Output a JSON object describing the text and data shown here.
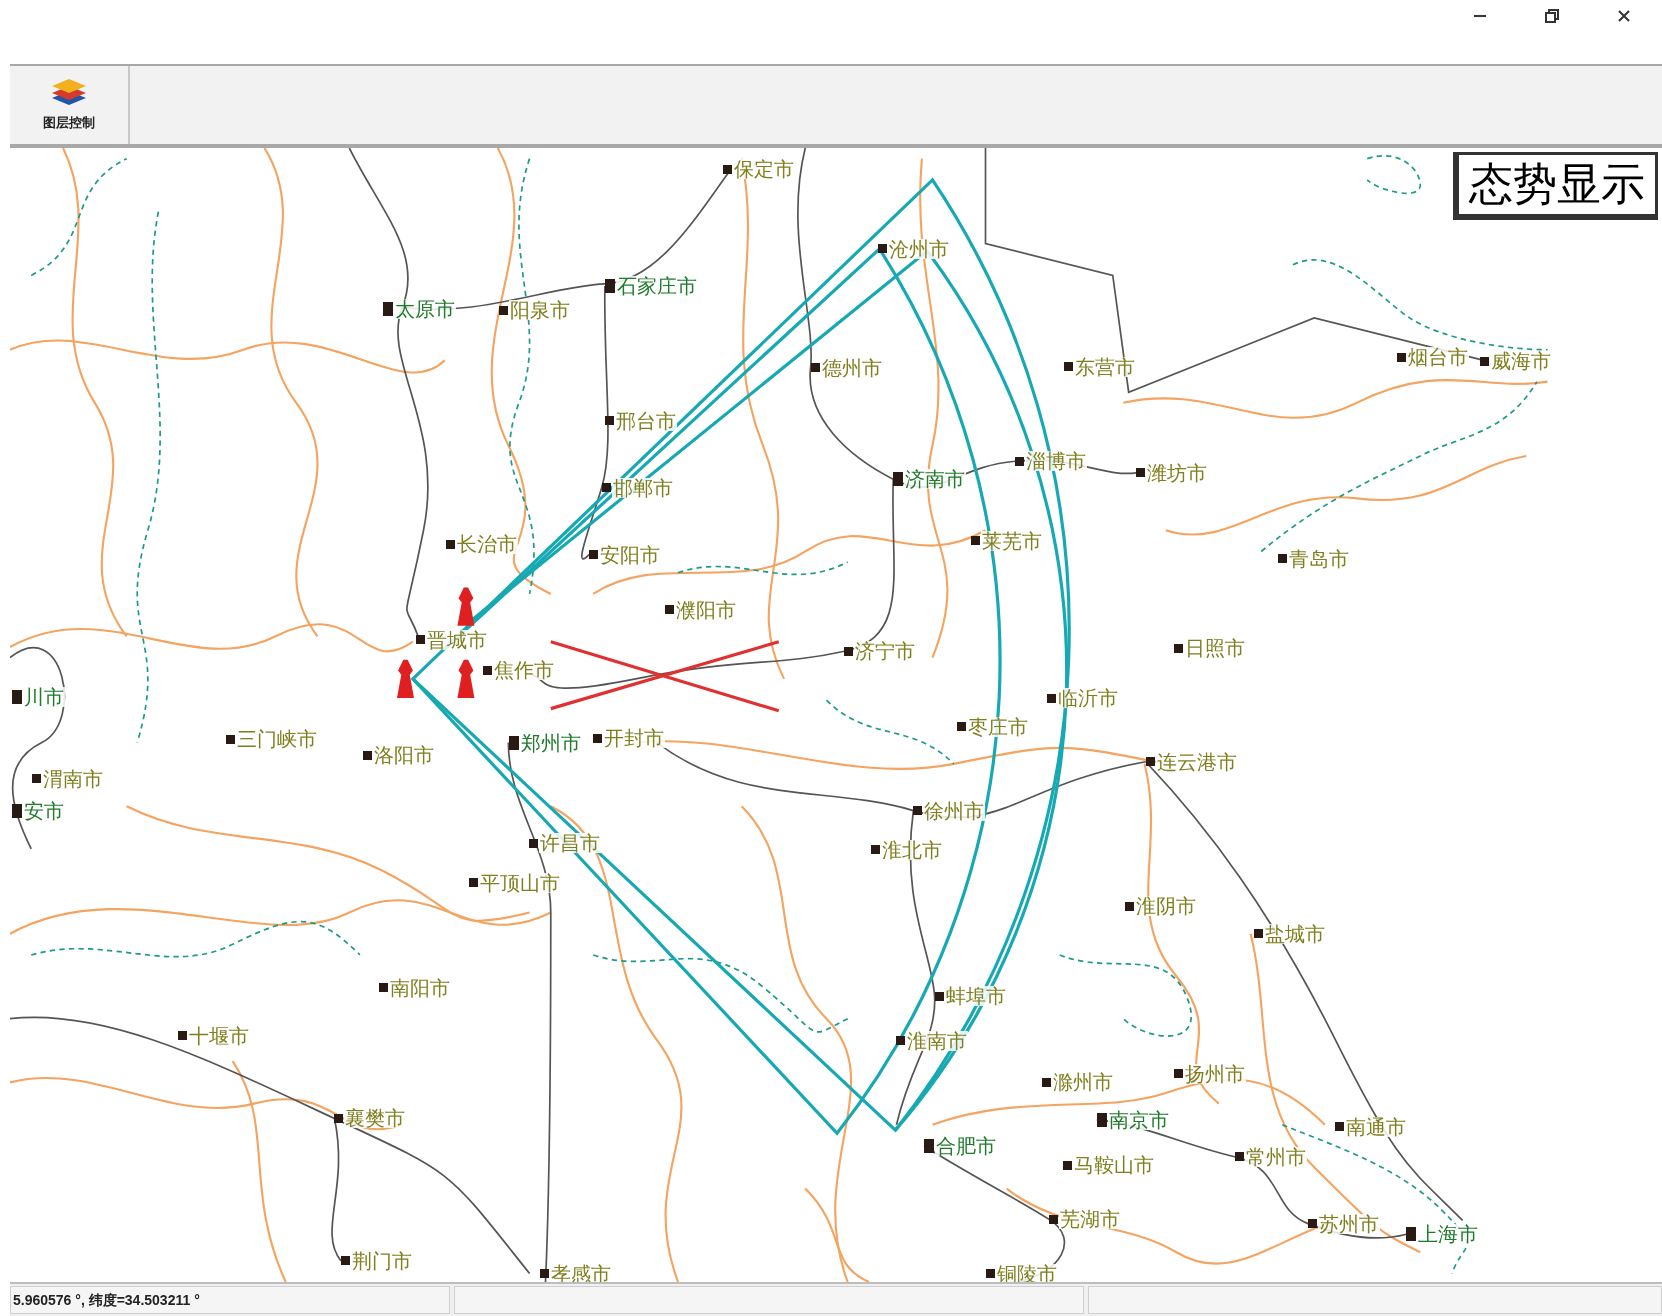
{
  "toolbar": {
    "buttons": [
      {
        "label": "图层控制"
      }
    ]
  },
  "map": {
    "overlay_title": "态势显示",
    "cities": [
      {
        "name": "保定市",
        "kind": "city"
      },
      {
        "name": "沧州市",
        "kind": "city"
      },
      {
        "name": "石家庄市",
        "kind": "capital"
      },
      {
        "name": "太原市",
        "kind": "capital"
      },
      {
        "name": "阳泉市",
        "kind": "city"
      },
      {
        "name": "德州市",
        "kind": "city"
      },
      {
        "name": "东营市",
        "kind": "city"
      },
      {
        "name": "烟台市",
        "kind": "city"
      },
      {
        "name": "威海市",
        "kind": "city"
      },
      {
        "name": "邢台市",
        "kind": "city"
      },
      {
        "name": "淄博市",
        "kind": "city"
      },
      {
        "name": "潍坊市",
        "kind": "city"
      },
      {
        "name": "济南市",
        "kind": "capital"
      },
      {
        "name": "邯郸市",
        "kind": "city"
      },
      {
        "name": "长治市",
        "kind": "city"
      },
      {
        "name": "安阳市",
        "kind": "city"
      },
      {
        "name": "莱芜市",
        "kind": "city"
      },
      {
        "name": "青岛市",
        "kind": "city"
      },
      {
        "name": "濮阳市",
        "kind": "city"
      },
      {
        "name": "晋城市",
        "kind": "city"
      },
      {
        "name": "济宁市",
        "kind": "city"
      },
      {
        "name": "日照市",
        "kind": "city"
      },
      {
        "name": "焦作市",
        "kind": "city"
      },
      {
        "name": "川市",
        "kind": "capital"
      },
      {
        "name": "临沂市",
        "kind": "city"
      },
      {
        "name": "枣庄市",
        "kind": "city"
      },
      {
        "name": "三门峡市",
        "kind": "city"
      },
      {
        "name": "洛阳市",
        "kind": "city"
      },
      {
        "name": "郑州市",
        "kind": "capital"
      },
      {
        "name": "开封市",
        "kind": "city"
      },
      {
        "name": "渭南市",
        "kind": "city"
      },
      {
        "name": "连云港市",
        "kind": "city"
      },
      {
        "name": "安市",
        "kind": "capital"
      },
      {
        "name": "徐州市",
        "kind": "city"
      },
      {
        "name": "淮北市",
        "kind": "city"
      },
      {
        "name": "许昌市",
        "kind": "city"
      },
      {
        "name": "平顶山市",
        "kind": "city"
      },
      {
        "name": "淮阴市",
        "kind": "city"
      },
      {
        "name": "盐城市",
        "kind": "city"
      },
      {
        "name": "南阳市",
        "kind": "city"
      },
      {
        "name": "蚌埠市",
        "kind": "city"
      },
      {
        "name": "十堰市",
        "kind": "city"
      },
      {
        "name": "淮南市",
        "kind": "city"
      },
      {
        "name": "滁州市",
        "kind": "city"
      },
      {
        "name": "扬州市",
        "kind": "city"
      },
      {
        "name": "襄樊市",
        "kind": "city"
      },
      {
        "name": "南京市",
        "kind": "capital"
      },
      {
        "name": "南通市",
        "kind": "city"
      },
      {
        "name": "合肥市",
        "kind": "capital"
      },
      {
        "name": "马鞍山市",
        "kind": "city"
      },
      {
        "name": "常州市",
        "kind": "city"
      },
      {
        "name": "荆门市",
        "kind": "city"
      },
      {
        "name": "苏州市",
        "kind": "city"
      },
      {
        "name": "上海市",
        "kind": "capital"
      },
      {
        "name": "芜湖市",
        "kind": "city"
      },
      {
        "name": "铜陵市",
        "kind": "city"
      },
      {
        "name": "孝感市",
        "kind": "city"
      }
    ]
  },
  "status_bar": {
    "coordinates": "5.960576 °, 纬度=34.503211 °"
  }
}
